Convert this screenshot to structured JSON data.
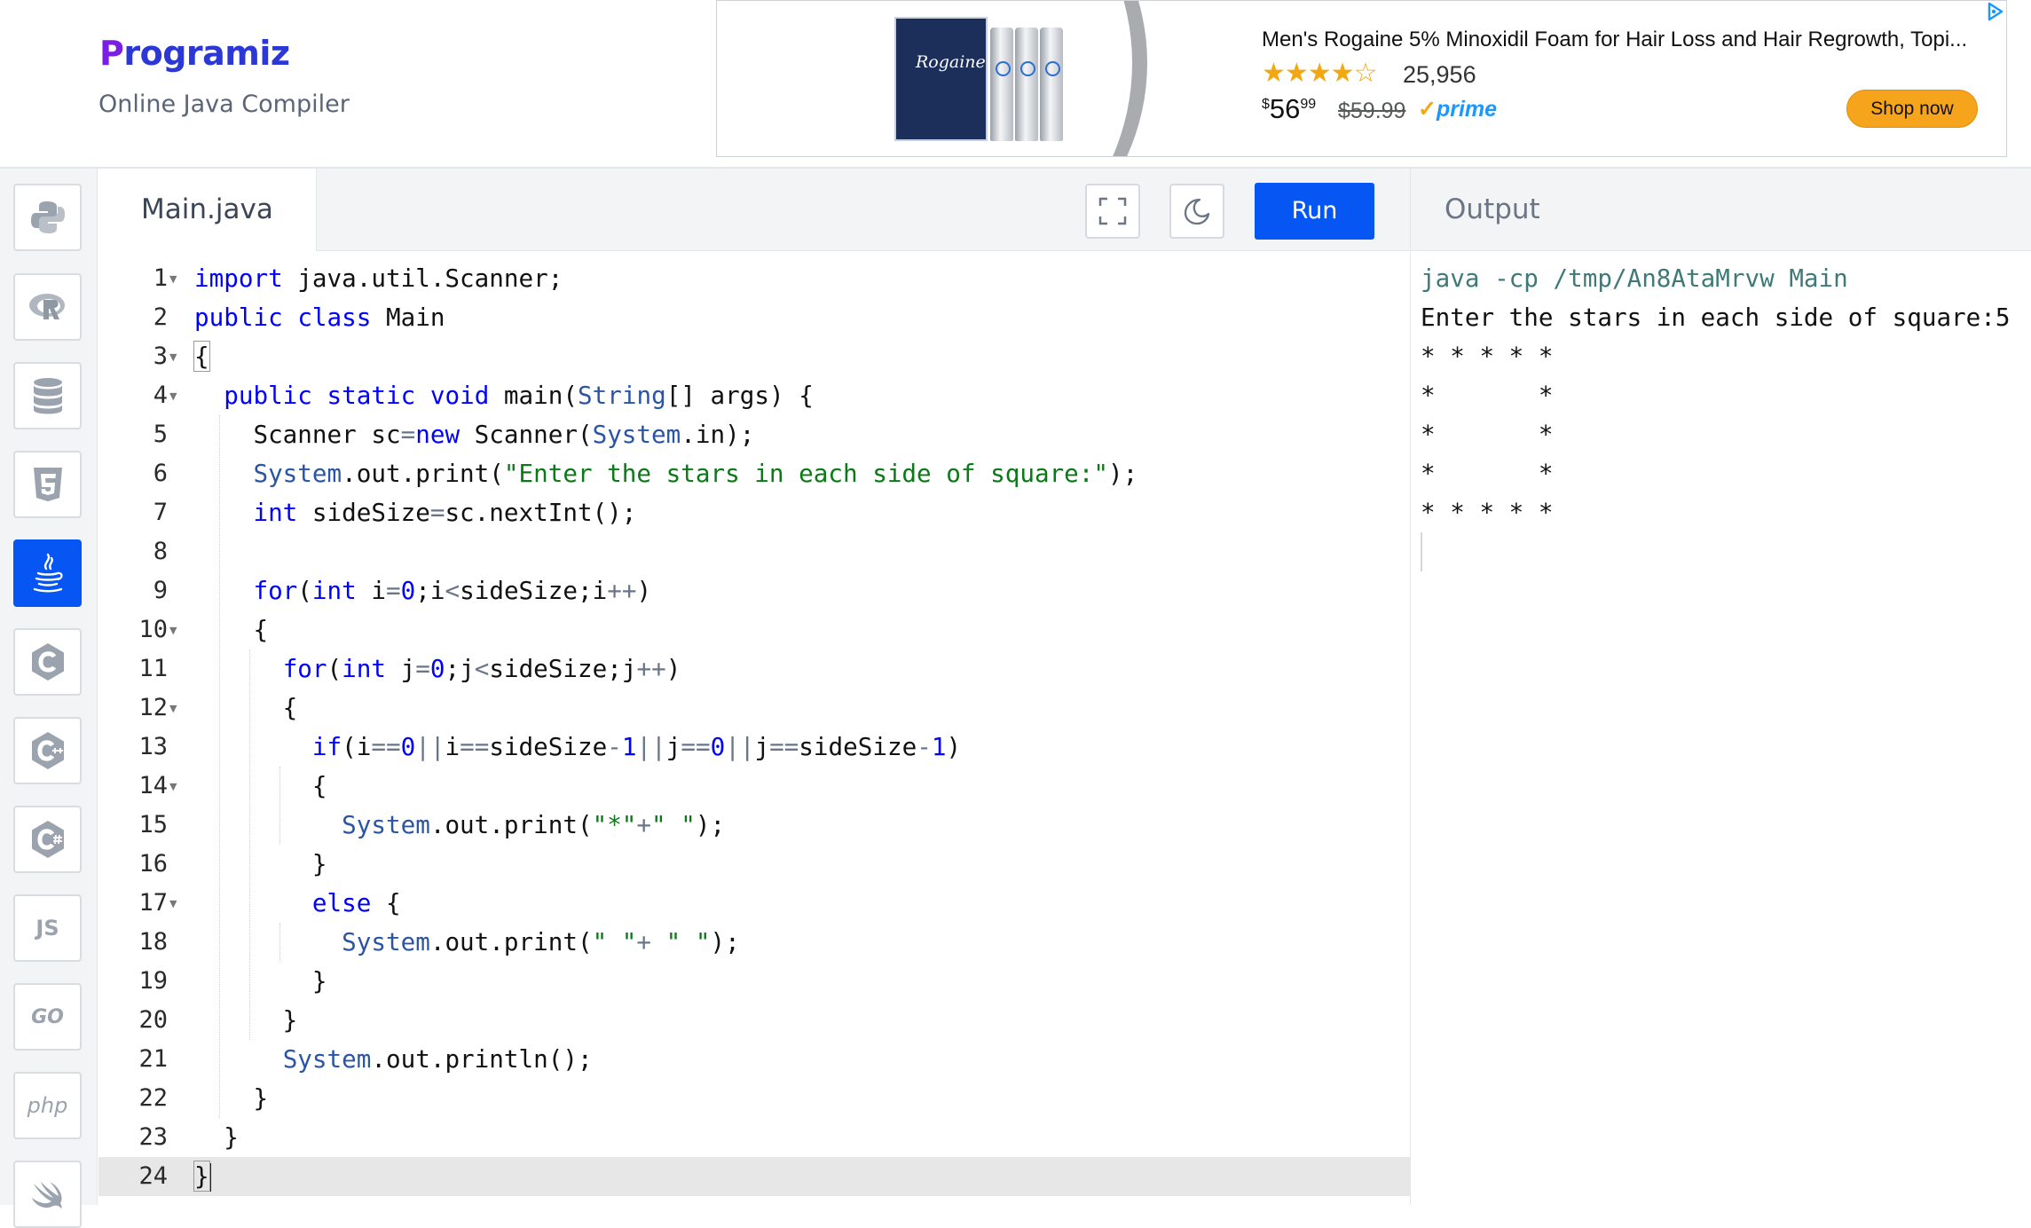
{
  "header": {
    "logo": "Programiz",
    "subtitle": "Online Java Compiler"
  },
  "ad": {
    "product_box_label": "Rogaine",
    "title": "Men's Rogaine 5% Minoxidil Foam for Hair Loss and Hair Regrowth, Topi...",
    "stars": "★★★★☆",
    "rating_count": "25,956",
    "price_currency": "$",
    "price_whole": "56",
    "price_fraction": "99",
    "old_price": "$59.99",
    "prime_label": "prime",
    "cta": "Shop now"
  },
  "sidebar": {
    "items": [
      {
        "name": "python",
        "icon": "python-icon"
      },
      {
        "name": "r",
        "icon": "r-icon"
      },
      {
        "name": "sql",
        "icon": "database-icon"
      },
      {
        "name": "html",
        "icon": "html5-icon"
      },
      {
        "name": "java",
        "icon": "java-icon",
        "active": true
      },
      {
        "name": "c",
        "icon": "c-icon"
      },
      {
        "name": "cpp",
        "icon": "cpp-icon"
      },
      {
        "name": "csharp",
        "icon": "csharp-icon"
      },
      {
        "name": "javascript",
        "label": "JS"
      },
      {
        "name": "go",
        "label": "GO"
      },
      {
        "name": "php",
        "label": "php"
      },
      {
        "name": "swift",
        "icon": "swift-icon"
      }
    ]
  },
  "editor": {
    "file_name": "Main.java",
    "run_label": "Run",
    "line_numbers": [
      "1",
      "2",
      "3",
      "4",
      "5",
      "6",
      "7",
      "8",
      "9",
      "10",
      "11",
      "12",
      "13",
      "14",
      "15",
      "16",
      "17",
      "18",
      "19",
      "20",
      "21",
      "22",
      "23",
      "24"
    ]
  },
  "output": {
    "title": "Output",
    "lines": [
      "java -cp /tmp/An8AtaMrvw Main",
      "Enter the stars in each side of square:5",
      "* * * * * ",
      "*       * ",
      "*       * ",
      "*       * ",
      "* * * * * "
    ]
  },
  "colors": {
    "accent": "#0556f3",
    "keyword": "#0000ff",
    "type": "#2a55a5",
    "string": "#0a7a17",
    "command_output": "#3f7a78"
  }
}
